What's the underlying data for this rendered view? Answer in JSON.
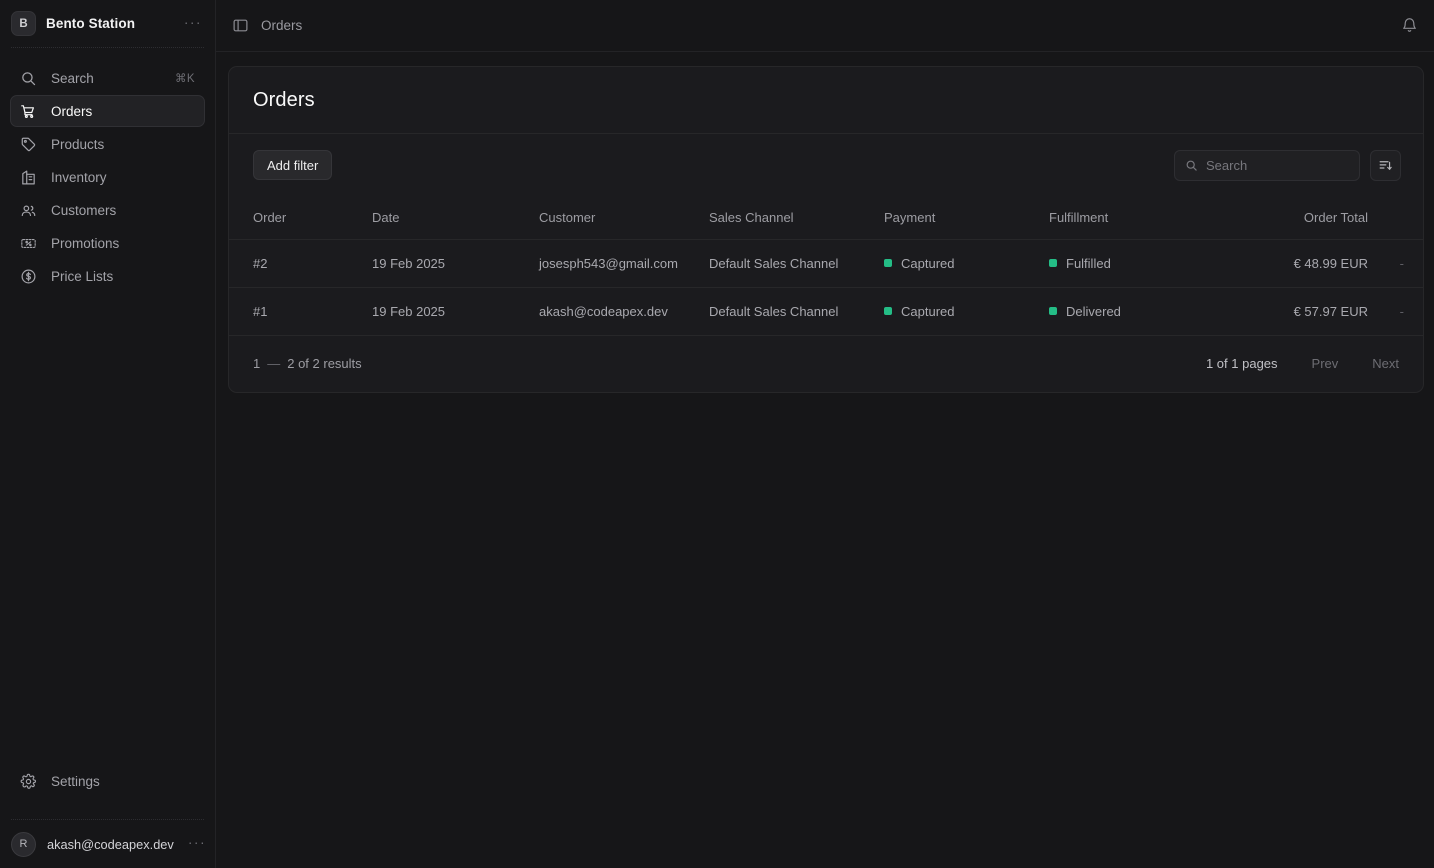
{
  "sidebar": {
    "workspace": {
      "initial": "B",
      "name": "Bento Station",
      "menu": "···"
    },
    "items": [
      {
        "label": "Search",
        "icon": "search-icon",
        "shortcut": "⌘K",
        "active": false
      },
      {
        "label": "Orders",
        "icon": "cart-icon",
        "shortcut": "",
        "active": true
      },
      {
        "label": "Products",
        "icon": "tag-icon",
        "shortcut": "",
        "active": false
      },
      {
        "label": "Inventory",
        "icon": "warehouse-icon",
        "shortcut": "",
        "active": false
      },
      {
        "label": "Customers",
        "icon": "users-icon",
        "shortcut": "",
        "active": false
      },
      {
        "label": "Promotions",
        "icon": "ticket-percent-icon",
        "shortcut": "",
        "active": false
      },
      {
        "label": "Price Lists",
        "icon": "dollar-circle-icon",
        "shortcut": "",
        "active": false
      }
    ],
    "settings": {
      "label": "Settings",
      "icon": "gear-icon"
    },
    "user": {
      "initial": "R",
      "email": "akash@codeapex.dev",
      "menu": "···"
    }
  },
  "topbar": {
    "toggle_icon": "sidebar-toggle-icon",
    "breadcrumb": "Orders",
    "notification_icon": "bell-icon"
  },
  "page": {
    "title": "Orders",
    "toolbar": {
      "add_filter_label": "Add filter",
      "search_placeholder": "Search",
      "search_value": "",
      "search_icon": "search-icon",
      "sort_button_icon": "sort-descending-icon"
    },
    "table": {
      "columns": [
        "Order",
        "Date",
        "Customer",
        "Sales Channel",
        "Payment",
        "Fulfillment",
        "Order Total",
        ""
      ],
      "rows": [
        {
          "order": "#2",
          "date": "19 Feb 2025",
          "customer": "josesph543@gmail.com",
          "channel": "Default Sales Channel",
          "payment": "Captured",
          "payment_color": "#24bd86",
          "fulfillment": "Fulfilled",
          "fulfillment_color": "#24bd86",
          "total": "€ 48.99 EUR",
          "end": "-"
        },
        {
          "order": "#1",
          "date": "19 Feb 2025",
          "customer": "akash@codeapex.dev",
          "channel": "Default Sales Channel",
          "payment": "Captured",
          "payment_color": "#24bd86",
          "fulfillment": "Delivered",
          "fulfillment_color": "#24bd86",
          "total": "€ 57.97 EUR",
          "end": "-"
        }
      ]
    },
    "pagination": {
      "range_start": "1",
      "range_dash": "—",
      "range_end_text": "2 of 2 results",
      "pages_text": "1 of 1 pages",
      "prev_label": "Prev",
      "next_label": "Next"
    }
  }
}
